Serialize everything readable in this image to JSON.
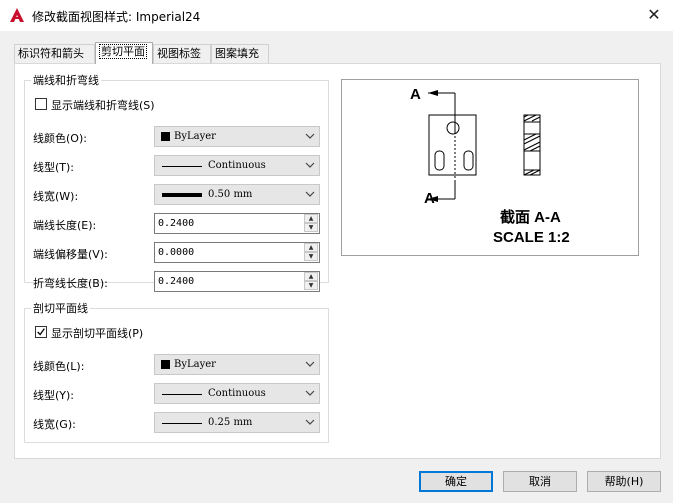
{
  "window": {
    "title": "修改截面视图样式: Imperial24",
    "app_icon": "autocad-icon",
    "close_label": "✕"
  },
  "tabs": [
    {
      "label": "标识符和箭头",
      "active": false
    },
    {
      "label": "剪切平面",
      "active": true
    },
    {
      "label": "视图标签",
      "active": false
    },
    {
      "label": "图案填充",
      "active": false
    }
  ],
  "end_bend_group": {
    "title": "端线和折弯线",
    "show_checkbox": {
      "label": "显示端线和折弯线(S)",
      "checked": false
    },
    "color": {
      "label": "线颜色(O):",
      "value": "ByLayer"
    },
    "linetype": {
      "label": "线型(T):",
      "value": "Continuous"
    },
    "lineweight": {
      "label": "线宽(W):",
      "value": "0.50 mm"
    },
    "end_length": {
      "label": "端线长度(E):",
      "value": "0.2400"
    },
    "end_offset": {
      "label": "端线偏移量(V):",
      "value": "0.0000"
    },
    "bend_length": {
      "label": "折弯线长度(B):",
      "value": "0.2400"
    }
  },
  "cutting_plane_group": {
    "title": "剖切平面线",
    "show_checkbox": {
      "label": "显示剖切平面线(P)",
      "checked": true
    },
    "color": {
      "label": "线颜色(L):",
      "value": "ByLayer"
    },
    "linetype": {
      "label": "线型(Y):",
      "value": "Continuous"
    },
    "lineweight": {
      "label": "线宽(G):",
      "value": "0.25 mm"
    }
  },
  "preview": {
    "label_top": "A",
    "label_bottom": "A",
    "caption_line1": "截面  A-A",
    "caption_line2": "SCALE 1:2"
  },
  "buttons": {
    "ok": "确定",
    "cancel": "取消",
    "help": "帮助(H)"
  },
  "colors": {
    "accent": "#0078d7",
    "autocad_red": "#c8102e"
  }
}
